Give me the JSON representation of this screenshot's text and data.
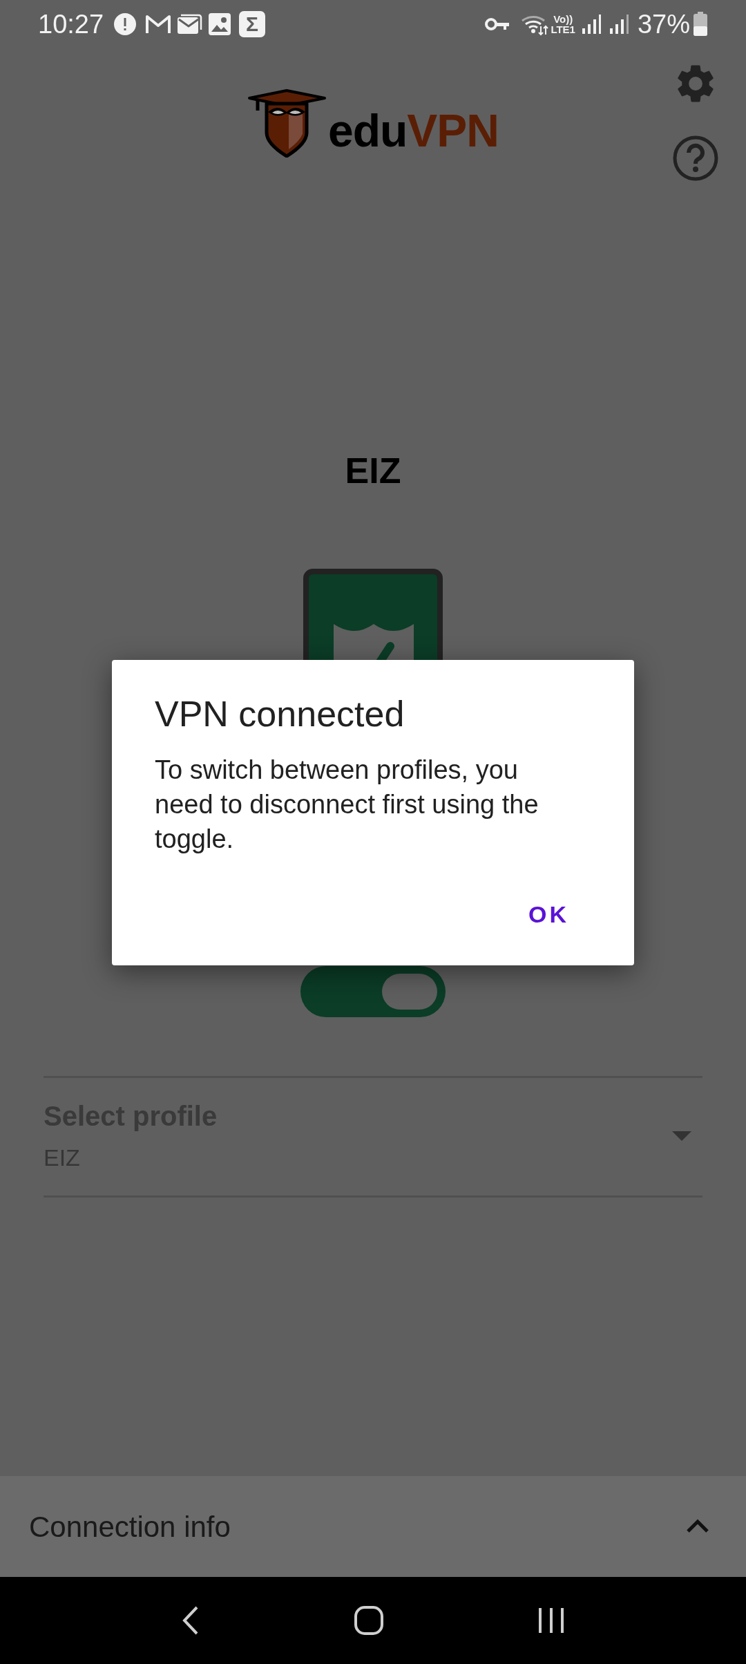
{
  "status_bar": {
    "time": "10:27",
    "app_icon_text": "Σ",
    "network_label_top": "Vo))",
    "network_label_bottom": "LTE1",
    "battery": "37%"
  },
  "header": {
    "logo_text_dark": "edu",
    "logo_text_accent": "VPN"
  },
  "server": {
    "title": "EIZ"
  },
  "connection_toggle": {
    "on": true
  },
  "profile_select": {
    "label": "Select profile",
    "value": "EIZ"
  },
  "connection_info": {
    "label": "Connection info",
    "expanded": false
  },
  "dialog": {
    "title": "VPN connected",
    "message": "To switch between profiles, you need to disconnect first using the toggle.",
    "button": "OK"
  }
}
